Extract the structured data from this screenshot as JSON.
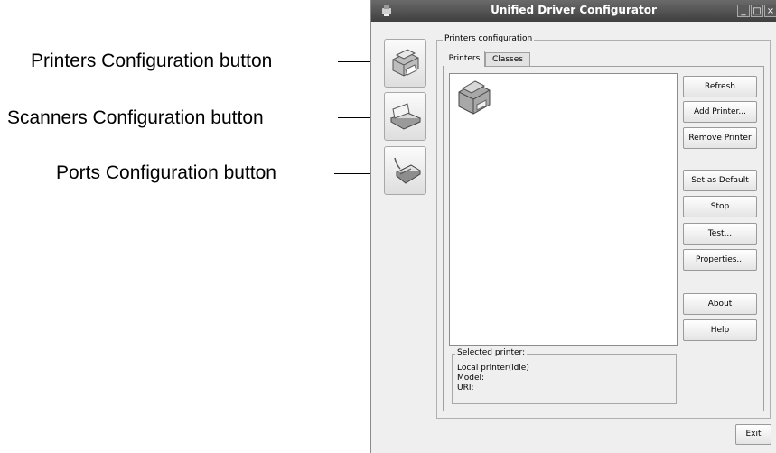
{
  "callouts": {
    "printers": "Printers Configuration button",
    "scanners": "Scanners Configuration button",
    "ports": "Ports Configuration button"
  },
  "window": {
    "title": "Unified Driver Configurator",
    "minimize": "_",
    "maximize": "□",
    "close": "×"
  },
  "sidebar": {
    "items": [
      {
        "name": "printers",
        "icon": "printer-icon"
      },
      {
        "name": "scanners",
        "icon": "scanner-icon"
      },
      {
        "name": "ports",
        "icon": "port-icon"
      }
    ]
  },
  "panel": {
    "group_title": "Printers configuration",
    "tabs": [
      "Printers",
      "Classes"
    ],
    "active_tab": "Printers"
  },
  "actions": {
    "refresh": "Refresh",
    "add_printer": "Add Printer...",
    "remove_printer": "Remove Printer",
    "set_default": "Set as Default",
    "stop": "Stop",
    "test": "Test...",
    "properties": "Properties...",
    "about": "About",
    "help": "Help"
  },
  "selected": {
    "title": "Selected printer:",
    "status": "Local printer(idle)",
    "model": "Model:",
    "uri": "URI:"
  },
  "footer": {
    "exit": "Exit"
  },
  "colors": {
    "titlebar": "#4a4a4a",
    "window_bg": "#efefef",
    "list_bg": "#ffffff"
  }
}
